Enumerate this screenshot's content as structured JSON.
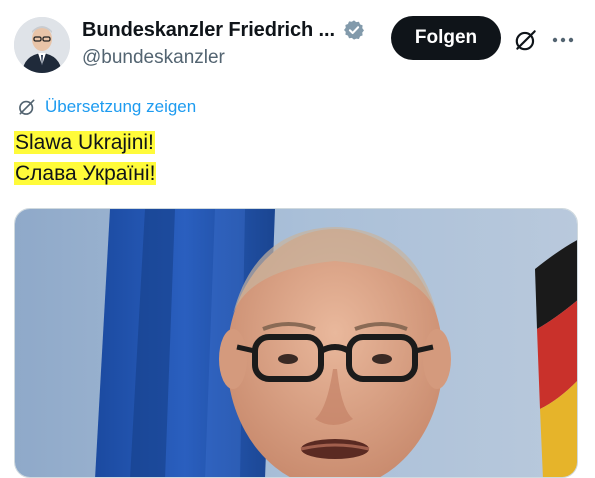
{
  "author": {
    "display_name": "Bundeskanzler Friedrich ...",
    "handle": "@bundeskanzler",
    "verified": true,
    "verified_color": "#829aab"
  },
  "actions": {
    "follow_label": "Folgen",
    "grok_icon": "grok-icon",
    "more_icon": "more-icon"
  },
  "translate": {
    "label": "Übersetzung zeigen",
    "color": "#1d9bf0"
  },
  "tweet": {
    "lines": [
      "Slawa Ukrajini!",
      "Слава Україні!"
    ],
    "highlight_color": "#fffb3a"
  },
  "media": {
    "alt_icon": "photo"
  }
}
